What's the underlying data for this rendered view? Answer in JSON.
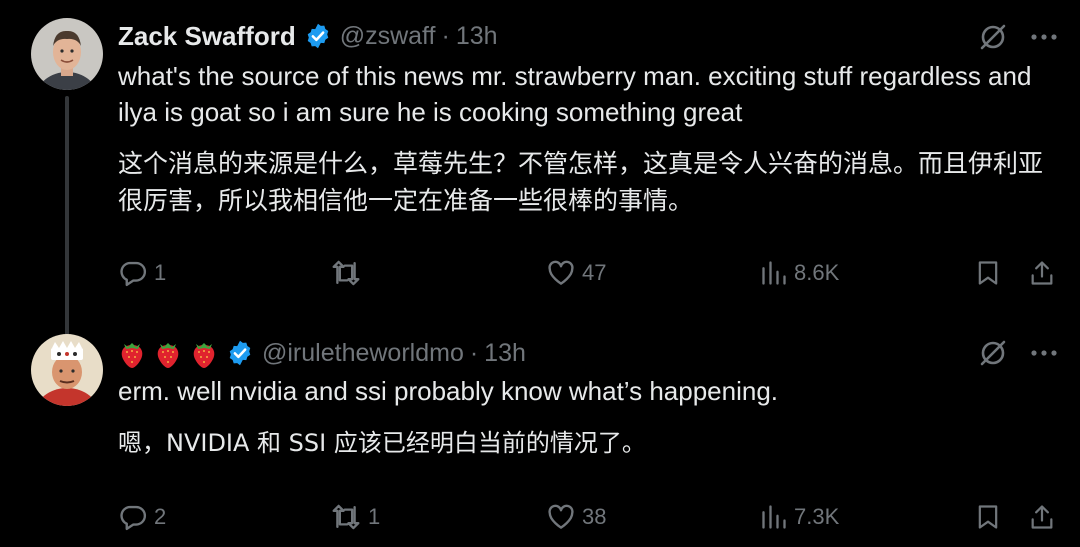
{
  "tweets": [
    {
      "display_name": "Zack Swafford",
      "handle": "@zswaff",
      "separator": "·",
      "time": "13h",
      "text_en": "what's the source of this news mr. strawberry man. exciting stuff regardless and ilya is goat so i am sure he is cooking something great",
      "text_zh": "这个消息的来源是什么，草莓先生？不管怎样，这真是令人兴奋的消息。而且伊利亚很厉害，所以我相信他一定在准备一些很棒的事情。",
      "replies": "1",
      "retweets": "",
      "likes": "47",
      "views": "8.6K"
    },
    {
      "display_name_emoji": [
        "strawberry",
        "strawberry",
        "strawberry"
      ],
      "handle": "@iruletheworldmo",
      "separator": "·",
      "time": "13h",
      "text_en": "erm. well nvidia and ssi probably know what’s happening.",
      "text_zh": "嗯，NVIDIA 和 SSI 应该已经明白当前的情况了。",
      "replies": "2",
      "retweets": "1",
      "likes": "38",
      "views": "7.3K"
    }
  ],
  "colors": {
    "background": "#000000",
    "text_primary": "#e7e9ea",
    "text_secondary": "#71767b",
    "verified_blue": "#1d9bf0",
    "thread_line": "#333639"
  },
  "icons": {
    "verified": "verified-badge-icon",
    "grok": "grok-icon",
    "more": "more-icon",
    "reply": "reply-icon",
    "retweet": "retweet-icon",
    "like": "heart-icon",
    "views": "views-icon",
    "bookmark": "bookmark-icon",
    "share": "share-icon"
  }
}
